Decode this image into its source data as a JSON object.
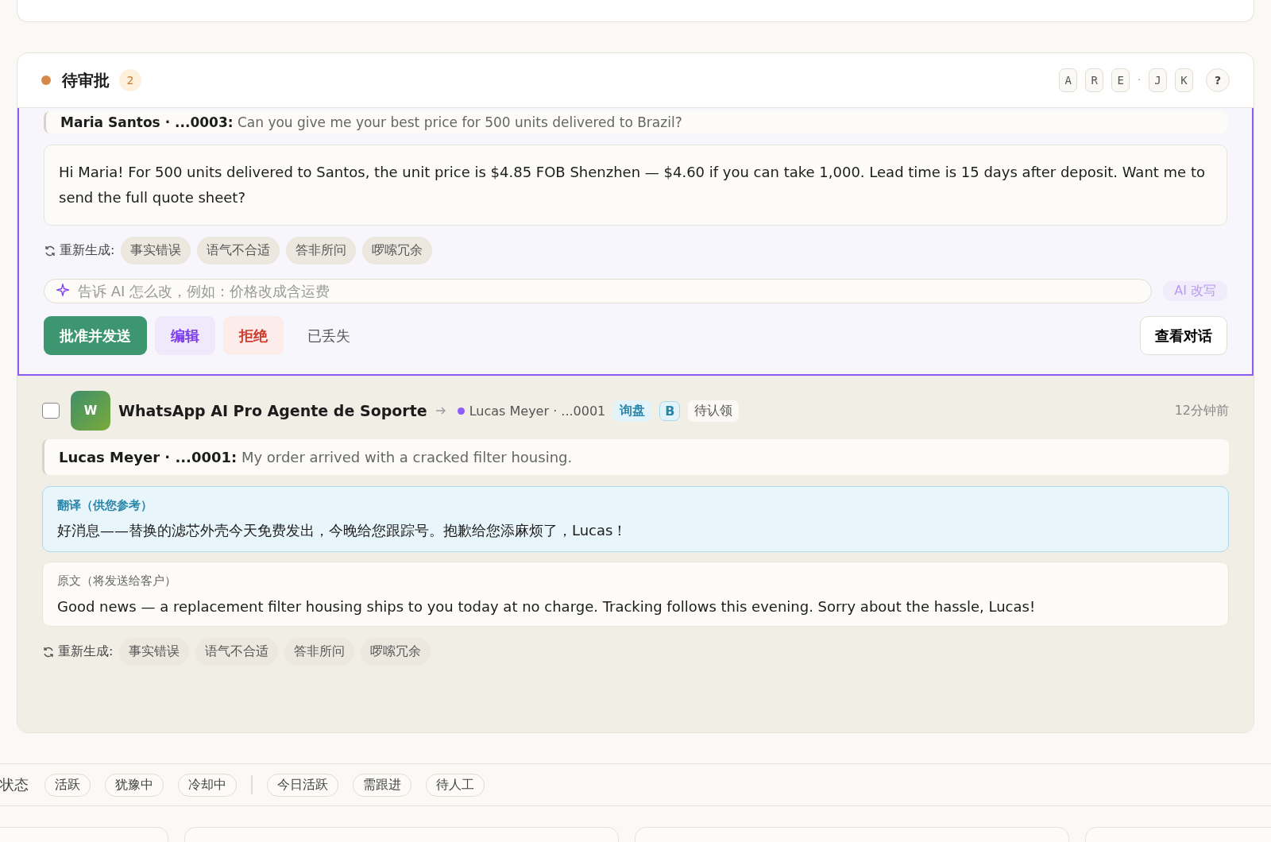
{
  "pending": {
    "title": "待审批",
    "count": "2",
    "shortcuts": [
      "A",
      "R",
      "E",
      "·",
      "J",
      "K"
    ],
    "help": "?"
  },
  "items": [
    {
      "selected": true,
      "quote": {
        "sender": "Maria Santos · ...0003:",
        "text": "Can you give me your best price for 500 units delivered to Brazil?"
      },
      "reply": "Hi Maria! For 500 units delivered to Santos, the unit price is $4.85 FOB Shenzhen — $4.60 if you can take 1,000. Lead time is 15 days after deposit. Want me to send the full quote sheet?",
      "regen_label": "重新生成:",
      "regen_tags": [
        "事实错误",
        "语气不合适",
        "答非所问",
        "啰嗦冗余"
      ],
      "ai_placeholder": "告诉 AI 怎么改，例如：价格改成含运费",
      "ai_button": "AI 改写",
      "actions": [
        {
          "kind": "approve",
          "label": "批准并发送"
        },
        {
          "kind": "edit",
          "label": "编辑"
        },
        {
          "kind": "reject",
          "label": "拒绝"
        },
        {
          "kind": "lost",
          "label": "已丢失"
        }
      ],
      "view": "查看对话"
    },
    {
      "selected": false,
      "checked": false,
      "avatar": "W",
      "bot": "WhatsApp AI Pro Agente de Soporte",
      "contact": "Lucas Meyer · ...0001",
      "tags": [
        {
          "kind": "intent",
          "label": "询盘"
        },
        {
          "kind": "grade",
          "label": "B"
        },
        {
          "kind": "status",
          "label": "待认领"
        }
      ],
      "time": "12分钟前",
      "quote": {
        "sender": "Lucas Meyer · ...0001:",
        "text": "My order arrived with a cracked filter housing."
      },
      "translation": {
        "label": "翻译（供您参考）",
        "text": "好消息——替换的滤芯外壳今天免费发出，今晚给您跟踪号。抱歉给您添麻烦了，Lucas！"
      },
      "original": {
        "label": "原文（将发送给客户）",
        "text": "Good news — a replacement filter housing ships to you today at no charge. Tracking follows this evening. Sorry about the hassle, Lucas!"
      },
      "regen_label": "重新生成:",
      "regen_tags": [
        "事实错误",
        "语气不合适",
        "答非所问",
        "啰嗦冗余"
      ]
    }
  ],
  "filters": {
    "label": "状态",
    "groups": [
      [
        "活跃",
        "犹豫中",
        "冷却中"
      ],
      [
        "今日活跃",
        "需跟进",
        "待人工"
      ]
    ]
  }
}
